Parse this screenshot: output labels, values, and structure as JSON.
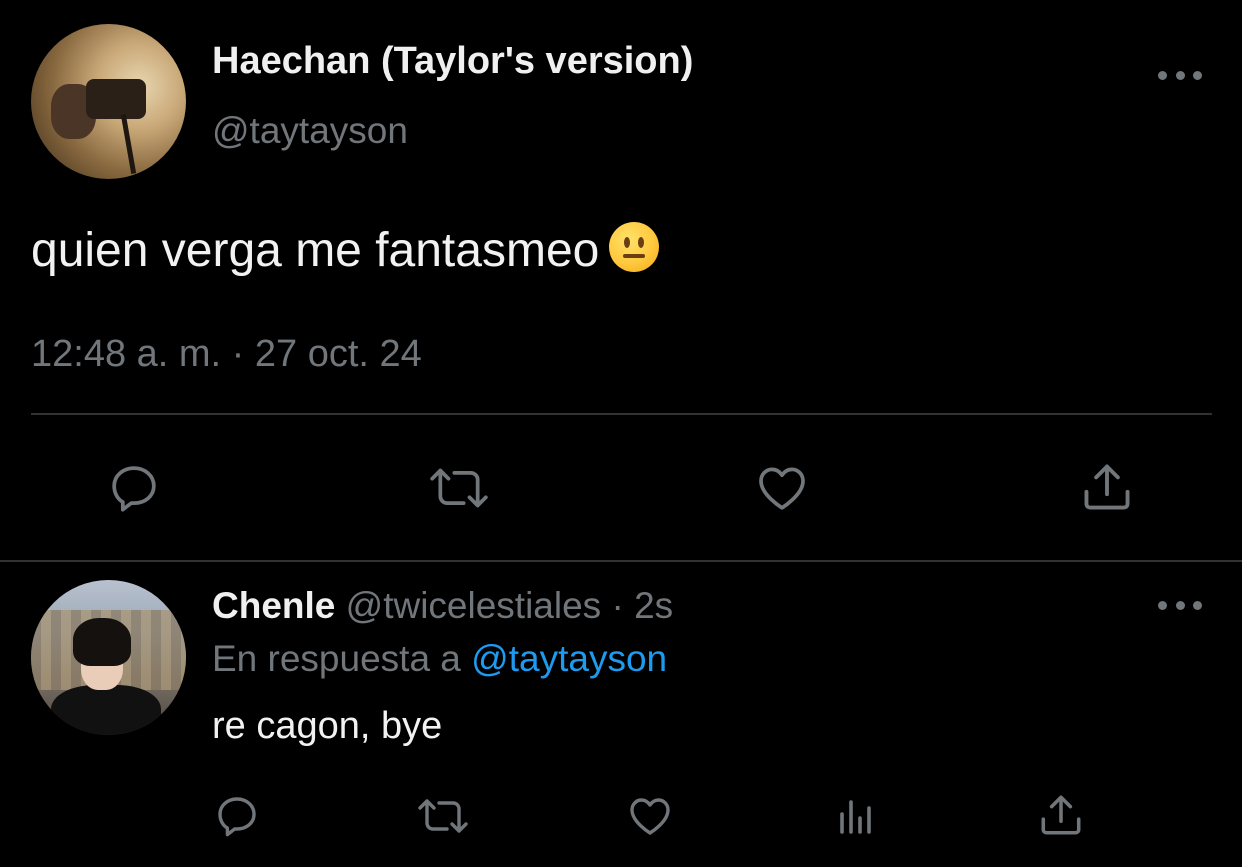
{
  "main_tweet": {
    "display_name": "Haechan (Taylor's version)",
    "handle": "@taytayson",
    "text": "quien verga me fantasmeo",
    "emoji": "neutral-face-emoji",
    "timestamp": "12:48 a. m. · 27 oct. 24",
    "actions": [
      "reply-icon",
      "retweet-icon",
      "like-icon",
      "share-icon"
    ]
  },
  "reply_tweet": {
    "display_name": "Chenle",
    "handle": "@twicelestiales",
    "separator": " · ",
    "time": "2s",
    "reply_prefix": "En respuesta a ",
    "reply_to": "@taytayson",
    "text": "re cagon, bye",
    "actions": [
      "reply-icon",
      "retweet-icon",
      "like-icon",
      "analytics-icon",
      "share-icon"
    ]
  },
  "colors": {
    "background": "#000000",
    "primary_text": "#e7e9ea",
    "secondary_text": "#71767b",
    "link": "#1d9bf0",
    "divider": "#2f3336"
  }
}
